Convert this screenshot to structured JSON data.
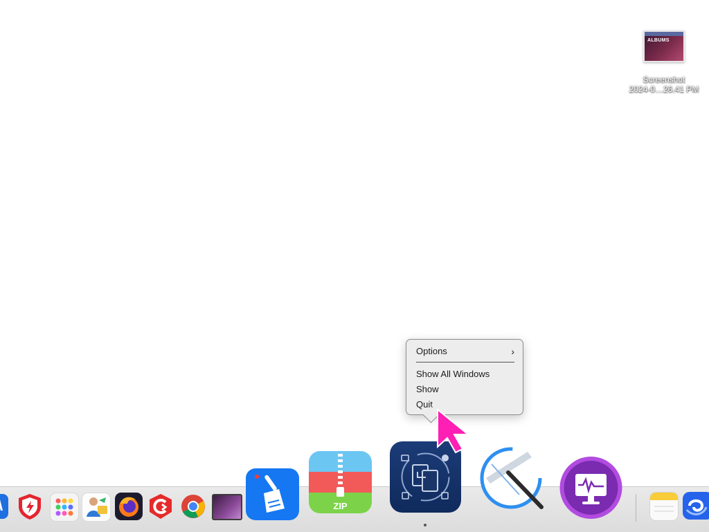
{
  "desktop": {
    "file": {
      "thumbnail_text": "ALBUMS",
      "name_line1": "Screenshot",
      "name_line2": "2024-0…26.41 PM"
    }
  },
  "context_menu": {
    "options_label": "Options",
    "options_chevron": "›",
    "items": [
      "Show All Windows",
      "Show",
      "Quit"
    ]
  },
  "dock": {
    "apps": [
      {
        "icon": "xcode-icon"
      },
      {
        "icon": "antivirus-shield-icon"
      },
      {
        "icon": "launchpad-icon"
      },
      {
        "icon": "character-app-icon"
      },
      {
        "icon": "firefox-icon"
      },
      {
        "icon": "red-c-app-icon"
      },
      {
        "icon": "chrome-icon"
      },
      {
        "icon": "screenshot-preview-icon"
      },
      {
        "icon": "broom-cleaner-icon"
      },
      {
        "icon": "zip-archive-icon"
      },
      {
        "icon": "file-transfer-icon"
      },
      {
        "icon": "squeegee-cleaner-icon"
      },
      {
        "icon": "activity-monitor-icon"
      },
      {
        "icon": "notes-icon"
      },
      {
        "icon": "wave-app-icon"
      }
    ]
  },
  "colors": {
    "accent_pointer": "#ff1fb4",
    "menu_bg": "#ececec"
  }
}
